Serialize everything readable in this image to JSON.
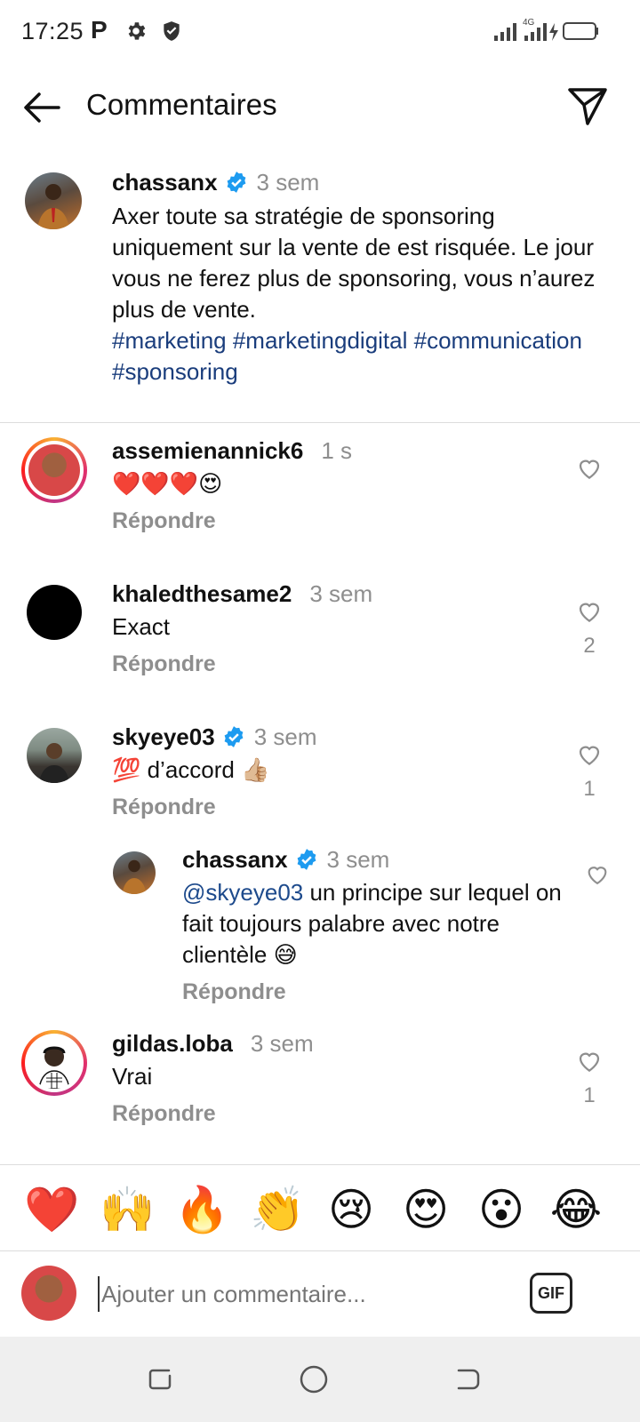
{
  "status": {
    "time": "17:25",
    "p_letter": "P",
    "network": "4G"
  },
  "header": {
    "title": "Commentaires"
  },
  "caption": {
    "username": "chassanx",
    "time": "3 sem",
    "text": "Axer toute sa stratégie de sponsoring uniquement sur la vente de est risquée. Le jour vous ne ferez plus de sponsoring, vous n’aurez plus de vente.",
    "hashtags": "#marketing #marketingdigital #communication #sponsoring"
  },
  "comments": [
    {
      "username": "assemienannick6",
      "time": "1 s",
      "text": "❤️❤️❤️😍",
      "reply": "Répondre",
      "likes": ""
    },
    {
      "username": "khaledthesame2",
      "time": "3 sem",
      "text": "Exact",
      "reply": "Répondre",
      "likes": "2"
    },
    {
      "username": "skyeye03",
      "time": "3 sem",
      "text": "💯 d’accord 👍🏼",
      "reply": "Répondre",
      "likes": "1"
    },
    {
      "username": "chassanx",
      "time": "3 sem",
      "mention": "@skyeye03",
      "text": " un principe sur lequel on fait toujours palabre avec notre clientèle 😅",
      "reply": "Répondre",
      "likes": ""
    },
    {
      "username": "gildas.loba",
      "time": "3 sem",
      "text": "Vrai",
      "reply": "Répondre",
      "likes": "1"
    }
  ],
  "emoji_bar": [
    "❤️",
    "🙌",
    "🔥",
    "👏",
    "😢",
    "😍",
    "😮",
    "😂"
  ],
  "composer": {
    "placeholder": "Ajouter un commentaire...",
    "gif_label": "GIF"
  },
  "colors": {
    "hashtag": "#1a3d7c",
    "verified": "#1d9bf0",
    "muted": "#8e8e8e"
  }
}
